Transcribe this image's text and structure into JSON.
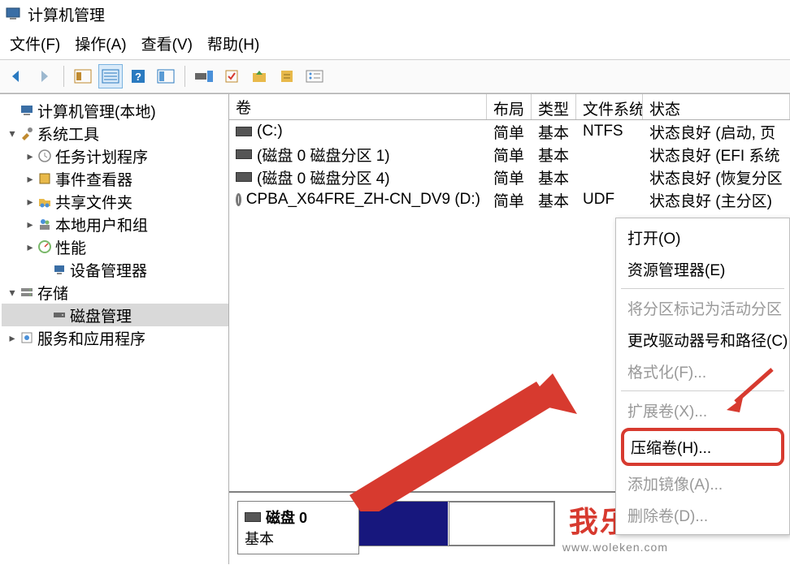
{
  "window": {
    "title": "计算机管理"
  },
  "menu": {
    "file": "文件(F)",
    "action": "操作(A)",
    "view": "查看(V)",
    "help": "帮助(H)"
  },
  "tree": {
    "root": "计算机管理(本地)",
    "systools": "系统工具",
    "task": "任务计划程序",
    "eventviewer": "事件查看器",
    "sharedfolders": "共享文件夹",
    "localusers": "本地用户和组",
    "perf": "性能",
    "devmgr": "设备管理器",
    "storage": "存储",
    "diskmgmt": "磁盘管理",
    "services": "服务和应用程序"
  },
  "columns": {
    "volume": "卷",
    "layout": "布局",
    "type": "类型",
    "fs": "文件系统",
    "state": "状态"
  },
  "volumes": [
    {
      "name": "(C:)",
      "layout": "简单",
      "type": "基本",
      "fs": "NTFS",
      "state": "状态良好 (启动, 页"
    },
    {
      "name": "(磁盘 0 磁盘分区 1)",
      "layout": "简单",
      "type": "基本",
      "fs": "",
      "state": "状态良好 (EFI 系统"
    },
    {
      "name": "(磁盘 0 磁盘分区 4)",
      "layout": "简单",
      "type": "基本",
      "fs": "",
      "state": "状态良好 (恢复分区"
    },
    {
      "name": "CPBA_X64FRE_ZH-CN_DV9 (D:)",
      "layout": "简单",
      "type": "基本",
      "fs": "UDF",
      "state": "状态良好 (主分区)"
    }
  ],
  "context": {
    "open": "打开(O)",
    "explorer": "资源管理器(E)",
    "markactive": "将分区标记为活动分区",
    "changeletter": "更改驱动器号和路径(C)",
    "format": "格式化(F)...",
    "extend": "扩展卷(X)...",
    "shrink": "压缩卷(H)...",
    "addmirror": "添加镜像(A)...",
    "delete": "删除卷(D)..."
  },
  "disk": {
    "label": "磁盘 0",
    "type": "基本"
  },
  "watermark": {
    "big": "我乐看",
    "small": "www.woleken.com"
  }
}
